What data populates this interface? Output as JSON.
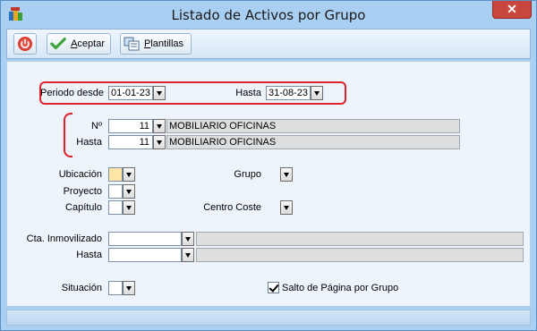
{
  "window": {
    "title": "Listado de Activos por Grupo",
    "close_glyph": "✕"
  },
  "toolbar": {
    "accept_label_u": "A",
    "accept_label_rest": "ceptar",
    "templates_label_u": "P",
    "templates_label_rest": "lantillas"
  },
  "period": {
    "from_label": "Periodo desde",
    "from_value": "01-01-23",
    "to_label": "Hasta",
    "to_value": "31-08-23"
  },
  "group_range": {
    "number_label": "Nº",
    "number_value": "11",
    "number_desc": "MOBILIARIO OFICINAS",
    "to_label": "Hasta",
    "to_value": "11",
    "to_desc": "MOBILIARIO OFICINAS"
  },
  "filters": {
    "location_label": "Ubicación",
    "project_label": "Proyecto",
    "chapter_label": "Capítulo",
    "group_label": "Grupo",
    "cost_center_label": "Centro Coste"
  },
  "account": {
    "from_label": "Cta. Inmovilizado",
    "to_label": "Hasta"
  },
  "situation": {
    "label": "Situación"
  },
  "page_break": {
    "label": "Salto de Página por Grupo",
    "checked": true
  }
}
